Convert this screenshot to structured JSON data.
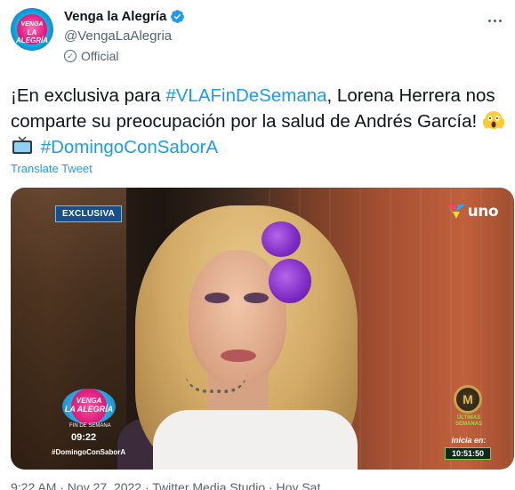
{
  "author": {
    "name": "Venga la Alegría",
    "handle": "@VengaLaAlegria",
    "label": "Official",
    "avatar_text_top": "VENGA",
    "avatar_text_bottom": "LA ALEGRÍA"
  },
  "tweet": {
    "part1": "¡En exclusiva para ",
    "hashtag1": "#VLAFinDeSemana",
    "part2": ", Lorena Herrera nos comparte su preocupación por la salud de Andrés García! ",
    "emoji1": "face-screaming-icon",
    "emoji2": "television-icon",
    "hashtag2": "#DomingoConSaborA",
    "translate": "Translate Tweet"
  },
  "media": {
    "badge": "EXCLUSIVA",
    "channel_logo": "uno",
    "show_logo_top": "VENGA",
    "show_logo_bottom": "LA ALEGRÍA",
    "show_sub": "FIN DE SEMANA",
    "clock": "09:22",
    "hashtag_overlay": "#DomingoConSaborA",
    "mc_logo": "M",
    "ultimas": "ÚLTIMAS SEMANAS",
    "inicia": "inicia en:",
    "countdown": "10:51:50"
  },
  "footer": {
    "text": "9:22 AM · Nov 27, 2022 · Twitter Media Studio · Hoy Sat"
  },
  "colors": {
    "accent": "#1d9bf0",
    "text": "#0f1419",
    "secondary": "#536471"
  }
}
